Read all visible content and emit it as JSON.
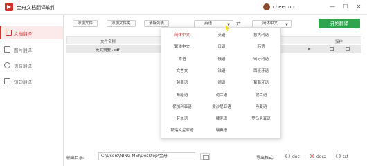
{
  "titlebar": {
    "app_title": "金舟文档翻译软件",
    "user_name": "cheer up",
    "controls": {
      "minimize": "—",
      "maximize": "☐",
      "close": "✕"
    }
  },
  "sidebar": {
    "items": [
      {
        "label": "文档翻译",
        "icon": "document-icon",
        "active": true
      },
      {
        "label": "图片翻译",
        "icon": "image-icon",
        "active": false
      },
      {
        "label": "语音翻译",
        "icon": "audio-icon",
        "active": false
      },
      {
        "label": "短句翻译",
        "icon": "sentence-icon",
        "active": false
      }
    ]
  },
  "toolbar": {
    "add_file": "添加文件",
    "add_folder": "添加文件夹",
    "clear_list": "清除列表",
    "source_lang": "英语",
    "target_lang": "简体中文",
    "swap_icon": "⇄",
    "start": "开始翻译"
  },
  "table": {
    "col_name": "文件名称",
    "col_action": "操作",
    "rows": [
      {
        "name": "英文摘要 .pdf"
      }
    ]
  },
  "dropdown": {
    "options": [
      "简体中文",
      "英语",
      "意大利语",
      "繁体中文",
      "日语",
      "韩语",
      "粤语",
      "俄语",
      "匈牙利语",
      "文言文",
      "法语",
      "西班牙语",
      "越南语",
      "德语",
      "葡萄牙语",
      "希腊语",
      "荷兰语",
      "波兰语",
      "保加利亚语",
      "爱沙尼亚语",
      "丹麦语",
      "芬兰语",
      "捷克语",
      "罗马尼亚语",
      "斯洛文尼亚语",
      "瑞典语"
    ],
    "selected": "简体中文"
  },
  "output": {
    "label": "输出目录:",
    "path": "C:\\Users\\NING MEI\\Desktop\\金舟",
    "format_label": "导出格式:",
    "formats": [
      "doc",
      "docx",
      "txt"
    ],
    "selected_format": "docx"
  },
  "colors": {
    "accent": "#cc3333",
    "start_button": "#2ea44f"
  }
}
